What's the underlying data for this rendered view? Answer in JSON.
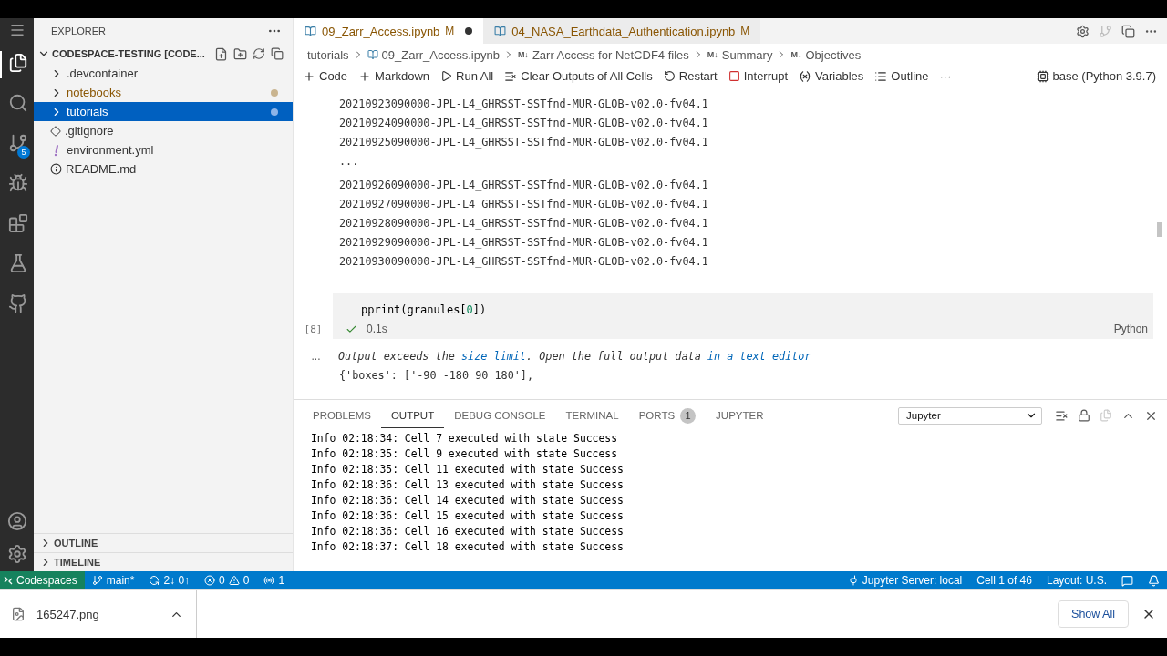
{
  "activity_bar": {
    "items": [
      {
        "kind": "files",
        "selected": true
      },
      {
        "kind": "search",
        "selected": false
      },
      {
        "kind": "source-control",
        "selected": false,
        "badge": "5"
      },
      {
        "kind": "run",
        "selected": false
      },
      {
        "kind": "extensions",
        "selected": false
      },
      {
        "kind": "testing",
        "selected": false
      },
      {
        "kind": "github",
        "selected": false
      }
    ]
  },
  "explorer": {
    "title": "EXPLORER",
    "root": {
      "label": "CODESPACE-TESTING [CODE...",
      "expanded": true
    },
    "items": [
      {
        "label": ".devcontainer",
        "kind": "folder",
        "selected": false,
        "modified": false
      },
      {
        "label": "notebooks",
        "kind": "folder",
        "selected": false,
        "modified": true
      },
      {
        "label": "tutorials",
        "kind": "folder",
        "selected": true,
        "modified": true
      },
      {
        "label": ".gitignore",
        "kind": "git",
        "selected": false,
        "modified": false
      },
      {
        "label": "environment.yml",
        "kind": "yaml",
        "selected": false,
        "modified": false
      },
      {
        "label": "README.md",
        "kind": "info",
        "selected": false,
        "modified": false
      }
    ],
    "sections": [
      {
        "label": "OUTLINE",
        "expanded": false
      },
      {
        "label": "TIMELINE",
        "expanded": false
      }
    ]
  },
  "tabs": [
    {
      "label": "09_Zarr_Access.ipynb",
      "status": "M",
      "dirty": true,
      "selected": true
    },
    {
      "label": "04_NASA_Earthdata_Authentication.ipynb",
      "status": "M",
      "dirty": false,
      "selected": false
    }
  ],
  "breadcrumbs": [
    {
      "label": "tutorials",
      "kind": "folder"
    },
    {
      "label": "09_Zarr_Access.ipynb",
      "kind": "notebook"
    },
    {
      "label": "Zarr Access for NetCDF4 files",
      "kind": "markdown",
      "marker": "M↓"
    },
    {
      "label": "Summary",
      "kind": "markdown",
      "marker": "M↓"
    },
    {
      "label": "Objectives",
      "kind": "markdown",
      "marker": "M↓"
    }
  ],
  "toolbar": [
    {
      "label": "Code",
      "kind": "plus"
    },
    {
      "label": "Markdown",
      "kind": "plus"
    },
    {
      "label": "Run All",
      "kind": "run"
    },
    {
      "label": "Clear Outputs of All Cells",
      "kind": "clear"
    },
    {
      "label": "Restart",
      "kind": "restart"
    },
    {
      "label": "Interrupt",
      "kind": "interrupt"
    },
    {
      "label": "Variables",
      "kind": "variables"
    },
    {
      "label": "Outline",
      "kind": "outline"
    },
    {
      "label": "···",
      "kind": "more"
    },
    {
      "label": "base (Python 3.9.7)",
      "kind": "kernel"
    }
  ],
  "output_lines": [
    "20210923090000-JPL-L4_GHRSST-SSTfnd-MUR-GLOB-v02.0-fv04.1",
    "20210924090000-JPL-L4_GHRSST-SSTfnd-MUR-GLOB-v02.0-fv04.1",
    "20210925090000-JPL-L4_GHRSST-SSTfnd-MUR-GLOB-v02.0-fv04.1"
  ],
  "output_ellipsis": "...",
  "output_lines_after": [
    "20210926090000-JPL-L4_GHRSST-SSTfnd-MUR-GLOB-v02.0-fv04.1",
    "20210927090000-JPL-L4_GHRSST-SSTfnd-MUR-GLOB-v02.0-fv04.1",
    "20210928090000-JPL-L4_GHRSST-SSTfnd-MUR-GLOB-v02.0-fv04.1",
    "20210929090000-JPL-L4_GHRSST-SSTfnd-MUR-GLOB-v02.0-fv04.1",
    "20210930090000-JPL-L4_GHRSST-SSTfnd-MUR-GLOB-v02.0-fv04.1"
  ],
  "cell": {
    "execution": "[8]",
    "code": [
      {
        "text": "pprint(granules[",
        "kind": "plain"
      },
      {
        "text": "0",
        "kind": "number"
      },
      {
        "text": "])",
        "kind": "plain"
      }
    ],
    "succeeded": true,
    "time": "0.1s",
    "language": "Python",
    "output_marker": "...",
    "message": [
      {
        "text": "Output exceeds the ",
        "kind": "text"
      },
      {
        "text": "size limit",
        "kind": "link"
      },
      {
        "text": ". Open the full output data ",
        "kind": "text"
      },
      {
        "text": "in a text editor",
        "kind": "link"
      }
    ],
    "result": "{'boxes': ['-90 -180 90 180'],"
  },
  "panel": {
    "tabs": [
      {
        "label": "PROBLEMS",
        "selected": false
      },
      {
        "label": "OUTPUT",
        "selected": true
      },
      {
        "label": "DEBUG CONSOLE",
        "selected": false
      },
      {
        "label": "TERMINAL",
        "selected": false
      },
      {
        "label": "PORTS",
        "selected": false,
        "badge": "1"
      },
      {
        "label": "JUPYTER",
        "selected": false
      }
    ],
    "channel": "Jupyter",
    "log": [
      "Info 02:18:34: Cell 7 executed with state Success",
      "Info 02:18:35: Cell 9 executed with state Success",
      "Info 02:18:35: Cell 11 executed with state Success",
      "Info 02:18:36: Cell 13 executed with state Success",
      "Info 02:18:36: Cell 14 executed with state Success",
      "Info 02:18:36: Cell 15 executed with state Success",
      "Info 02:18:36: Cell 16 executed with state Success",
      "Info 02:18:37: Cell 18 executed with state Success"
    ]
  },
  "status_bar": {
    "remote": "Codespaces",
    "branch": "main*",
    "sync": "2↓ 0↑",
    "errors": "0",
    "warnings": "0",
    "ports": "1",
    "server": "Jupyter Server: local",
    "cell": "Cell 1 of 46",
    "layout": "Layout: U.S."
  },
  "downloads": {
    "file": "165247.png",
    "show_all": "Show All"
  }
}
